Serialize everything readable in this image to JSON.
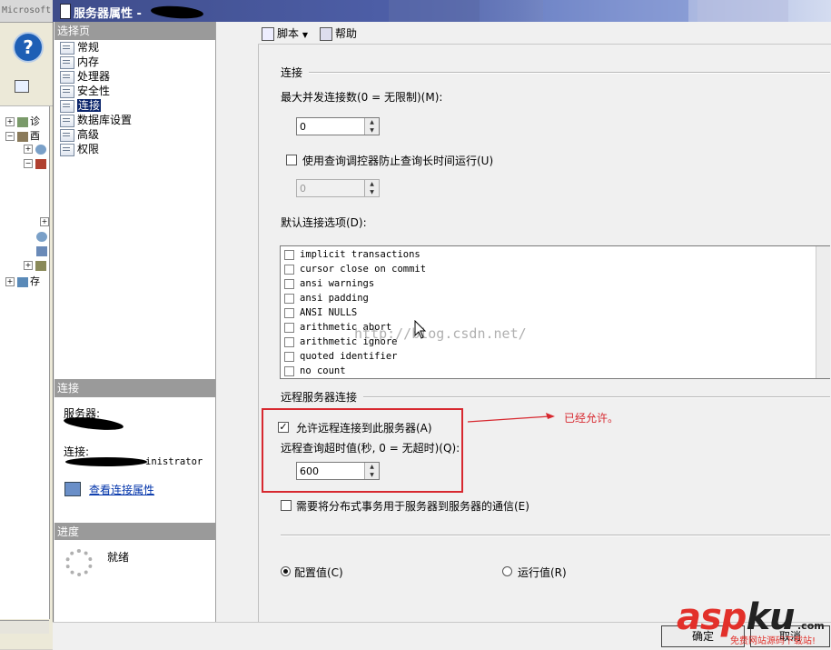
{
  "background_app": {
    "title": "Microsoft",
    "help_glyph": "?",
    "tree_nodes": [
      "诊",
      "酉",
      "存"
    ]
  },
  "dialog": {
    "title": "服务器属性 - ",
    "select_page": {
      "header": "选择页",
      "items": [
        "常规",
        "内存",
        "处理器",
        "安全性",
        "连接",
        "数据库设置",
        "高级",
        "权限"
      ],
      "selected": "连接"
    },
    "connection_info": {
      "header": "连接",
      "server_label": "服务器:",
      "connection_label": "连接:",
      "connection_value": "inistrator",
      "view_link": "查看连接属性"
    },
    "progress": {
      "header": "进度",
      "status": "就绪"
    },
    "toolbar": {
      "script_label": "脚本",
      "help_label": "帮助"
    },
    "connections": {
      "group_label": "连接",
      "max_connections_label": "最大并发连接数(0 = 无限制)(M):",
      "max_connections_value": "0",
      "governor_label": "使用查询调控器防止查询长时间运行(U)",
      "governor_checked": false,
      "governor_value": "0",
      "default_options_label": "默认连接选项(D):",
      "options": [
        "implicit transactions",
        "cursor close on commit",
        "ansi warnings",
        "ansi padding",
        "ANSI NULLS",
        "arithmetic abort",
        "arithmetic ignore",
        "quoted identifier",
        "no count"
      ]
    },
    "remote": {
      "group_label": "远程服务器连接",
      "allow_remote_label": "允许远程连接到此服务器(A)",
      "allow_remote_checked": true,
      "timeout_label": "远程查询超时值(秒, 0 = 无超时)(Q):",
      "timeout_value": "600",
      "distributed_label": "需要将分布式事务用于服务器到服务器的通信(E)",
      "distributed_checked": false
    },
    "values": {
      "configured_label": "配置值(C)",
      "running_label": "运行值(R)",
      "selected": "configured"
    },
    "buttons": {
      "ok_label": "确定",
      "cancel_label": "取消"
    }
  },
  "annotation": {
    "text": "已经允许。",
    "color": "#d7282f"
  },
  "watermark": {
    "text": "http://blog.csdn.net/"
  },
  "logo": {
    "part_red": "asp",
    "part_dark": "ku",
    "com": ".com",
    "tagline": "免费网站源码下载站!"
  }
}
